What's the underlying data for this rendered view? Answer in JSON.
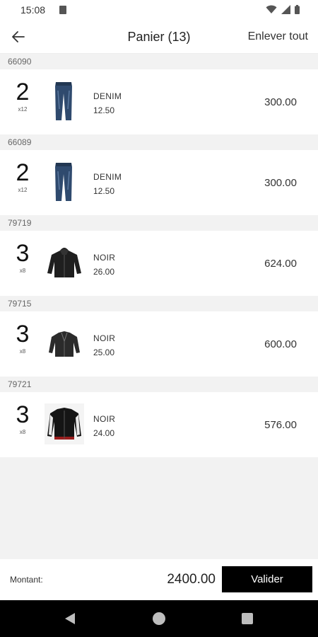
{
  "status": {
    "time": "15:08"
  },
  "header": {
    "title": "Panier (13)",
    "clear_all": "Enlever tout"
  },
  "groups": [
    {
      "code": "66090",
      "item": {
        "qty": "2",
        "qty_sub": "x12",
        "name": "DENIM",
        "unit_price": "12.50",
        "total": "300.00",
        "image": "jeans"
      }
    },
    {
      "code": "66089",
      "item": {
        "qty": "2",
        "qty_sub": "x12",
        "name": "DENIM",
        "unit_price": "12.50",
        "total": "300.00",
        "image": "jeans"
      }
    },
    {
      "code": "79719",
      "item": {
        "qty": "3",
        "qty_sub": "x8",
        "name": "NOIR",
        "unit_price": "26.00",
        "total": "624.00",
        "image": "black-jacket"
      }
    },
    {
      "code": "79715",
      "item": {
        "qty": "3",
        "qty_sub": "x8",
        "name": "NOIR",
        "unit_price": "25.00",
        "total": "600.00",
        "image": "black-jacket"
      }
    },
    {
      "code": "79721",
      "item": {
        "qty": "3",
        "qty_sub": "x8",
        "name": "NOIR",
        "unit_price": "24.00",
        "total": "576.00",
        "image": "bomber-jacket"
      }
    }
  ],
  "footer": {
    "amount_label": "Montant:",
    "amount_value": "2400.00",
    "validate_label": "Valider"
  },
  "colors": {
    "accent": "#000000",
    "background": "#f2f2f2",
    "card": "#ffffff"
  }
}
